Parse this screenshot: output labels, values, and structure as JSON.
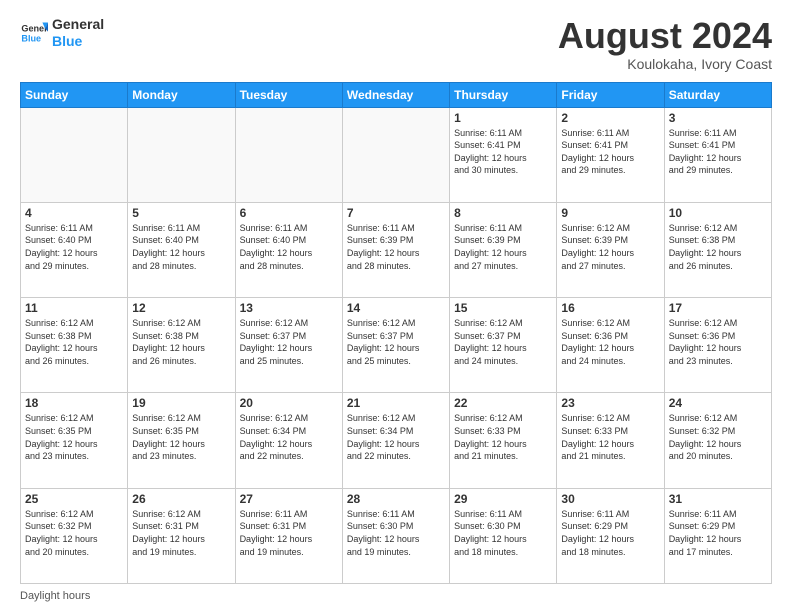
{
  "logo": {
    "line1": "General",
    "line2": "Blue"
  },
  "title": "August 2024",
  "subtitle": "Koulokaha, Ivory Coast",
  "days_of_week": [
    "Sunday",
    "Monday",
    "Tuesday",
    "Wednesday",
    "Thursday",
    "Friday",
    "Saturday"
  ],
  "footer_label": "Daylight hours",
  "weeks": [
    [
      {
        "day": "",
        "info": ""
      },
      {
        "day": "",
        "info": ""
      },
      {
        "day": "",
        "info": ""
      },
      {
        "day": "",
        "info": ""
      },
      {
        "day": "1",
        "info": "Sunrise: 6:11 AM\nSunset: 6:41 PM\nDaylight: 12 hours\nand 30 minutes."
      },
      {
        "day": "2",
        "info": "Sunrise: 6:11 AM\nSunset: 6:41 PM\nDaylight: 12 hours\nand 29 minutes."
      },
      {
        "day": "3",
        "info": "Sunrise: 6:11 AM\nSunset: 6:41 PM\nDaylight: 12 hours\nand 29 minutes."
      }
    ],
    [
      {
        "day": "4",
        "info": "Sunrise: 6:11 AM\nSunset: 6:40 PM\nDaylight: 12 hours\nand 29 minutes."
      },
      {
        "day": "5",
        "info": "Sunrise: 6:11 AM\nSunset: 6:40 PM\nDaylight: 12 hours\nand 28 minutes."
      },
      {
        "day": "6",
        "info": "Sunrise: 6:11 AM\nSunset: 6:40 PM\nDaylight: 12 hours\nand 28 minutes."
      },
      {
        "day": "7",
        "info": "Sunrise: 6:11 AM\nSunset: 6:39 PM\nDaylight: 12 hours\nand 28 minutes."
      },
      {
        "day": "8",
        "info": "Sunrise: 6:11 AM\nSunset: 6:39 PM\nDaylight: 12 hours\nand 27 minutes."
      },
      {
        "day": "9",
        "info": "Sunrise: 6:12 AM\nSunset: 6:39 PM\nDaylight: 12 hours\nand 27 minutes."
      },
      {
        "day": "10",
        "info": "Sunrise: 6:12 AM\nSunset: 6:38 PM\nDaylight: 12 hours\nand 26 minutes."
      }
    ],
    [
      {
        "day": "11",
        "info": "Sunrise: 6:12 AM\nSunset: 6:38 PM\nDaylight: 12 hours\nand 26 minutes."
      },
      {
        "day": "12",
        "info": "Sunrise: 6:12 AM\nSunset: 6:38 PM\nDaylight: 12 hours\nand 26 minutes."
      },
      {
        "day": "13",
        "info": "Sunrise: 6:12 AM\nSunset: 6:37 PM\nDaylight: 12 hours\nand 25 minutes."
      },
      {
        "day": "14",
        "info": "Sunrise: 6:12 AM\nSunset: 6:37 PM\nDaylight: 12 hours\nand 25 minutes."
      },
      {
        "day": "15",
        "info": "Sunrise: 6:12 AM\nSunset: 6:37 PM\nDaylight: 12 hours\nand 24 minutes."
      },
      {
        "day": "16",
        "info": "Sunrise: 6:12 AM\nSunset: 6:36 PM\nDaylight: 12 hours\nand 24 minutes."
      },
      {
        "day": "17",
        "info": "Sunrise: 6:12 AM\nSunset: 6:36 PM\nDaylight: 12 hours\nand 23 minutes."
      }
    ],
    [
      {
        "day": "18",
        "info": "Sunrise: 6:12 AM\nSunset: 6:35 PM\nDaylight: 12 hours\nand 23 minutes."
      },
      {
        "day": "19",
        "info": "Sunrise: 6:12 AM\nSunset: 6:35 PM\nDaylight: 12 hours\nand 23 minutes."
      },
      {
        "day": "20",
        "info": "Sunrise: 6:12 AM\nSunset: 6:34 PM\nDaylight: 12 hours\nand 22 minutes."
      },
      {
        "day": "21",
        "info": "Sunrise: 6:12 AM\nSunset: 6:34 PM\nDaylight: 12 hours\nand 22 minutes."
      },
      {
        "day": "22",
        "info": "Sunrise: 6:12 AM\nSunset: 6:33 PM\nDaylight: 12 hours\nand 21 minutes."
      },
      {
        "day": "23",
        "info": "Sunrise: 6:12 AM\nSunset: 6:33 PM\nDaylight: 12 hours\nand 21 minutes."
      },
      {
        "day": "24",
        "info": "Sunrise: 6:12 AM\nSunset: 6:32 PM\nDaylight: 12 hours\nand 20 minutes."
      }
    ],
    [
      {
        "day": "25",
        "info": "Sunrise: 6:12 AM\nSunset: 6:32 PM\nDaylight: 12 hours\nand 20 minutes."
      },
      {
        "day": "26",
        "info": "Sunrise: 6:12 AM\nSunset: 6:31 PM\nDaylight: 12 hours\nand 19 minutes."
      },
      {
        "day": "27",
        "info": "Sunrise: 6:11 AM\nSunset: 6:31 PM\nDaylight: 12 hours\nand 19 minutes."
      },
      {
        "day": "28",
        "info": "Sunrise: 6:11 AM\nSunset: 6:30 PM\nDaylight: 12 hours\nand 19 minutes."
      },
      {
        "day": "29",
        "info": "Sunrise: 6:11 AM\nSunset: 6:30 PM\nDaylight: 12 hours\nand 18 minutes."
      },
      {
        "day": "30",
        "info": "Sunrise: 6:11 AM\nSunset: 6:29 PM\nDaylight: 12 hours\nand 18 minutes."
      },
      {
        "day": "31",
        "info": "Sunrise: 6:11 AM\nSunset: 6:29 PM\nDaylight: 12 hours\nand 17 minutes."
      }
    ]
  ]
}
